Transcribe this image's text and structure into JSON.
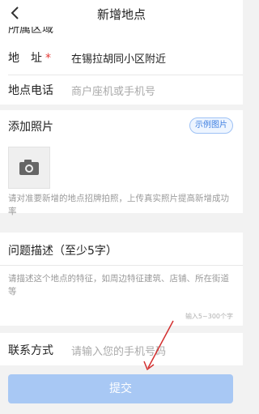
{
  "nav": {
    "title": "新增地点"
  },
  "form": {
    "cut_label": "所属区域",
    "address_label": "地　址",
    "address_required": "*",
    "address_value": "在锡拉胡同小区附近",
    "phone_label": "地点电话",
    "phone_placeholder": "商户座机或手机号",
    "photo_label": "添加照片",
    "sample_button": "示例图片",
    "photo_hint": "请对准要新增的地点招牌拍照，上传真实照片提高新增成功率",
    "desc_label": "问题描述（至少5字）",
    "desc_placeholder": "请描述这个地点的特征，如周边特征建筑、店铺、所在街道等",
    "desc_counter": "输入5~300个字",
    "contact_label": "联系方式",
    "contact_placeholder": "请输入您的手机号码",
    "submit_label": "提交"
  },
  "icons": {
    "back": "back-chevron-icon",
    "camera": "camera-icon"
  },
  "colors": {
    "accent": "#3b7de0",
    "submit_bg": "#a8c8f4",
    "required": "#e53935",
    "arrow": "#d32f2f"
  }
}
